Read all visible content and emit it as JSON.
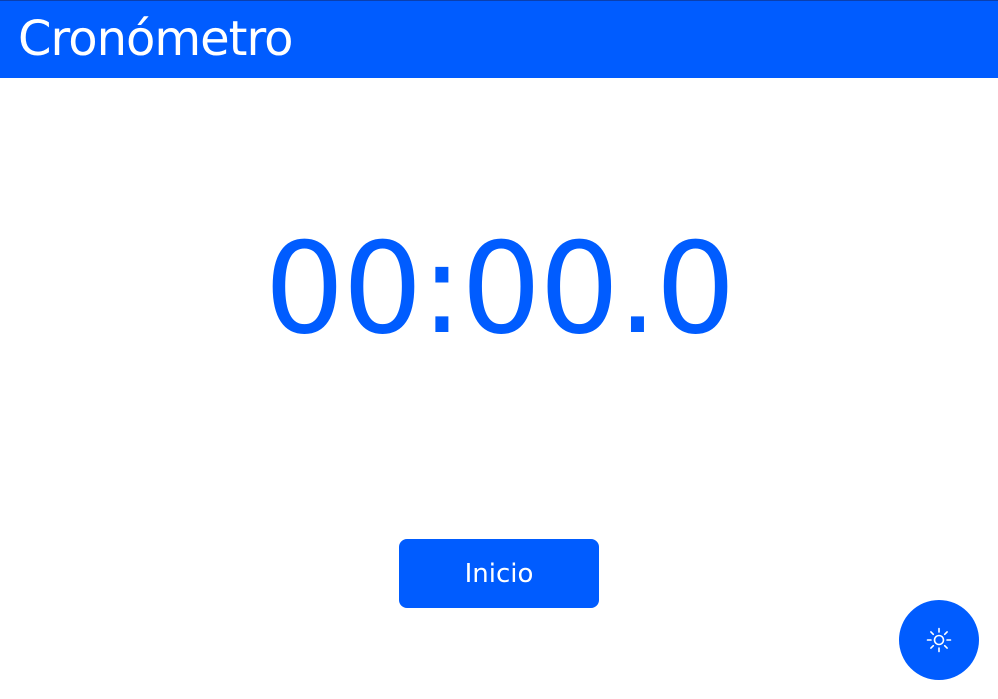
{
  "header": {
    "title": "Cronómetro"
  },
  "stopwatch": {
    "time": "00:00.0"
  },
  "controls": {
    "start_label": "Inicio",
    "theme_toggle_icon": "sun-icon"
  },
  "colors": {
    "accent": "#005cff",
    "background": "#ffffff",
    "on_accent": "#ffffff"
  }
}
